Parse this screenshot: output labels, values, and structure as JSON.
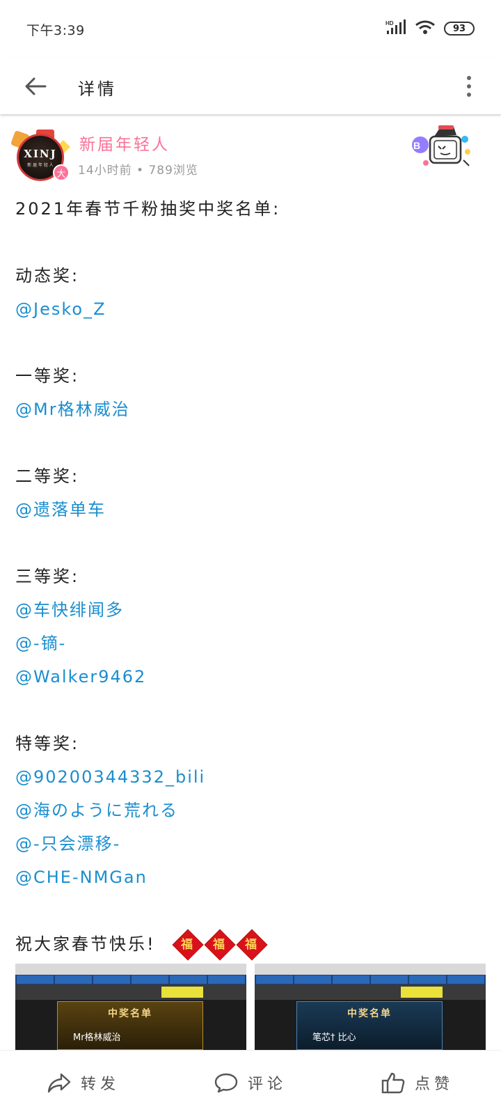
{
  "status_bar": {
    "time": "下午3:39",
    "network_label": "HD",
    "battery": "93"
  },
  "app_bar": {
    "title": "详情"
  },
  "author": {
    "name": "新届年轻人",
    "meta": "14小时前 • 789浏览",
    "avatar_logo": "XINJ",
    "avatar_sub": "新 届 年 轻 人",
    "avatar_badge": "大"
  },
  "post": {
    "lines": [
      {
        "type": "text",
        "text": "2021年春节千粉抽奖中奖名单:"
      },
      {
        "type": "blank",
        "text": ""
      },
      {
        "type": "text",
        "text": "动态奖:"
      },
      {
        "type": "at",
        "text": "@Jesko_Z"
      },
      {
        "type": "blank",
        "text": ""
      },
      {
        "type": "text",
        "text": "一等奖:"
      },
      {
        "type": "at",
        "text": "@Mr格林威治"
      },
      {
        "type": "blank",
        "text": ""
      },
      {
        "type": "text",
        "text": "二等奖:"
      },
      {
        "type": "at",
        "text": "@遗落单车"
      },
      {
        "type": "blank",
        "text": ""
      },
      {
        "type": "text",
        "text": "三等奖:"
      },
      {
        "type": "at",
        "text": "@车快绯闻多"
      },
      {
        "type": "at",
        "text": "@-镝-"
      },
      {
        "type": "at",
        "text": "@Walker9462"
      },
      {
        "type": "blank",
        "text": ""
      },
      {
        "type": "text",
        "text": "特等奖:"
      },
      {
        "type": "at",
        "text": "@90200344332_bili"
      },
      {
        "type": "at",
        "text": "@海のように荒れる"
      },
      {
        "type": "at",
        "text": "@-只会漂移-"
      },
      {
        "type": "at",
        "text": "@CHE-NMGan"
      },
      {
        "type": "blank",
        "text": ""
      }
    ],
    "closing": "祝大家春节快乐!",
    "fu_char": "福",
    "images": [
      {
        "title": "中奖名单",
        "name": "Mr格林威治",
        "theme": "gold"
      },
      {
        "title": "中奖名单",
        "name": "笔芯† 比心",
        "theme": "blue"
      }
    ]
  },
  "actions": {
    "share": "转发",
    "comment": "评论",
    "like": "点赞"
  },
  "colors": {
    "author_pink": "#fb7299",
    "mention_blue": "#1a8ecf",
    "fu_red": "#d8121a"
  }
}
